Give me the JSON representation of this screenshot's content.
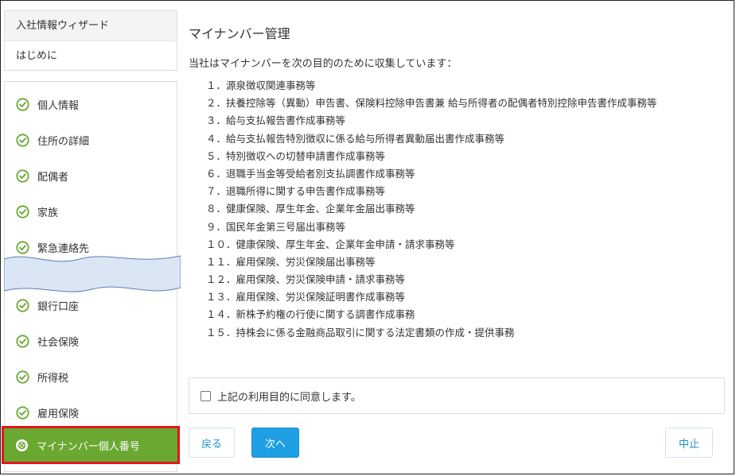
{
  "sidebar": {
    "header_items": [
      {
        "label": "入社情報ウィザード"
      },
      {
        "label": "はじめに"
      }
    ],
    "nav_items": [
      {
        "label": "個人情報",
        "status": "completed"
      },
      {
        "label": "住所の詳細",
        "status": "completed"
      },
      {
        "label": "配偶者",
        "status": "completed"
      },
      {
        "label": "家族",
        "status": "completed"
      },
      {
        "label": "緊急連絡先",
        "status": "completed"
      },
      {
        "label": "銀行口座",
        "status": "completed"
      },
      {
        "label": "社会保険",
        "status": "completed"
      },
      {
        "label": "所得税",
        "status": "completed"
      },
      {
        "label": "雇用保険",
        "status": "completed"
      },
      {
        "label": "マイナンバー個人番号",
        "status": "active"
      }
    ]
  },
  "main": {
    "title": "マイナンバー管理",
    "intro": "当社はマイナンバーを次の目的のために収集しています：",
    "purposes": [
      "１．源泉徴収関連事務等",
      "２．扶養控除等（異動）申告書、保険料控除申告書兼 給与所得者の配偶者特別控除申告書作成事務等",
      "３．給与支払報告書作成事務等",
      "４．給与支払報告特別徴収に係る給与所得者異動届出書作成事務等",
      "５．特別徴収への切替申請書作成事務等",
      "６．退職手当金等受給者別支払調書作成事務等",
      "７．退職所得に関する申告書作成事務等",
      "８．健康保険、厚生年金、企業年金届出事務等",
      "９．国民年金第三号届出事務等",
      "１０．健康保険、厚生年金、企業年金申請・請求事務等",
      "１１．雇用保険、労災保険届出事務等",
      "１２．雇用保険、労災保険申請・請求事務等",
      "１３．雇用保険、労災保険証明書作成事務等",
      "１４．新株予約権の行使に関する調書作成事務",
      "１５．持株会に係る金融商品取引に関する法定書類の作成・提供事務"
    ],
    "consent_label": "上記の利用目的に同意します。",
    "consent_checked": false,
    "buttons": {
      "back": "戻る",
      "next": "次へ",
      "cancel": "中止"
    }
  },
  "colors": {
    "check_green": "#6aa832",
    "active_bg": "#6aa832",
    "active_outline": "#e0161b",
    "primary_blue": "#1e9fe4",
    "link_blue": "#1a8fd0",
    "torn_fill": "#dbe6f5"
  },
  "icons": {
    "completed": "check-circle-icon",
    "active": "x-circle-icon"
  }
}
